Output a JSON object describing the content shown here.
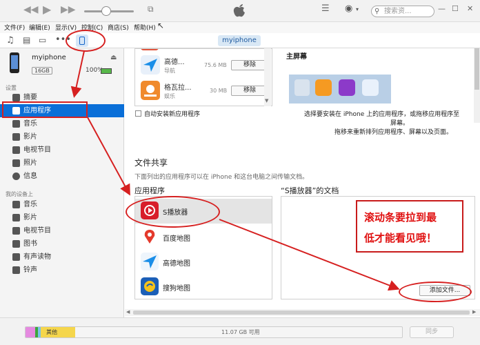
{
  "toolbar": {
    "search_placeholder": "搜索资..."
  },
  "menu": [
    "文件(F)",
    "编辑(E)",
    "显示(V)",
    "控制(C)",
    "商店(S)",
    "帮助(H)"
  ],
  "device_pill": "myiphone",
  "sidebar": {
    "device_name": "myiphone",
    "capacity": "16GB",
    "battery": "100%",
    "settings_head": "设置",
    "settings_items": [
      "摘要",
      "应用程序",
      "音乐",
      "影片",
      "电视节目",
      "照片",
      "信息"
    ],
    "my_device_head": "我的设备上",
    "device_items": [
      "音乐",
      "影片",
      "电视节目",
      "图书",
      "有声读物",
      "铃声"
    ]
  },
  "apps": [
    {
      "name": "高德...",
      "category": "导航",
      "size": "75.6 MB",
      "action": "移除"
    },
    {
      "name": "格瓦拉...",
      "category": "娱乐",
      "size": "30 MB",
      "action": "移除"
    }
  ],
  "home_screen": {
    "title": "主屏幕",
    "desc_line1": "选择要安装在 iPhone 上的应用程序，或拖移应用程序至",
    "desc_line2": "屏幕。",
    "desc_line3": "拖移来重新排列应用程序、屏幕以及页面。"
  },
  "auto_install_label": "自动安装新应用程序",
  "file_sharing": {
    "title": "文件共享",
    "desc": "下面列出的应用程序可以在 iPhone 和这台电脑之间传输文档。",
    "apps_head": "应用程序",
    "docs_head": "“S播放器”的文档",
    "apps": [
      "S播放器",
      "百度地图",
      "高德地图",
      "搜狗地图"
    ],
    "add_file": "添加文件..."
  },
  "callout": {
    "line1": "滚动条要拉到最",
    "line2": "低才能看见哦！"
  },
  "storage": {
    "other_label": "其他",
    "free_label": "11.07 GB 可用"
  },
  "sync_label": "同步"
}
